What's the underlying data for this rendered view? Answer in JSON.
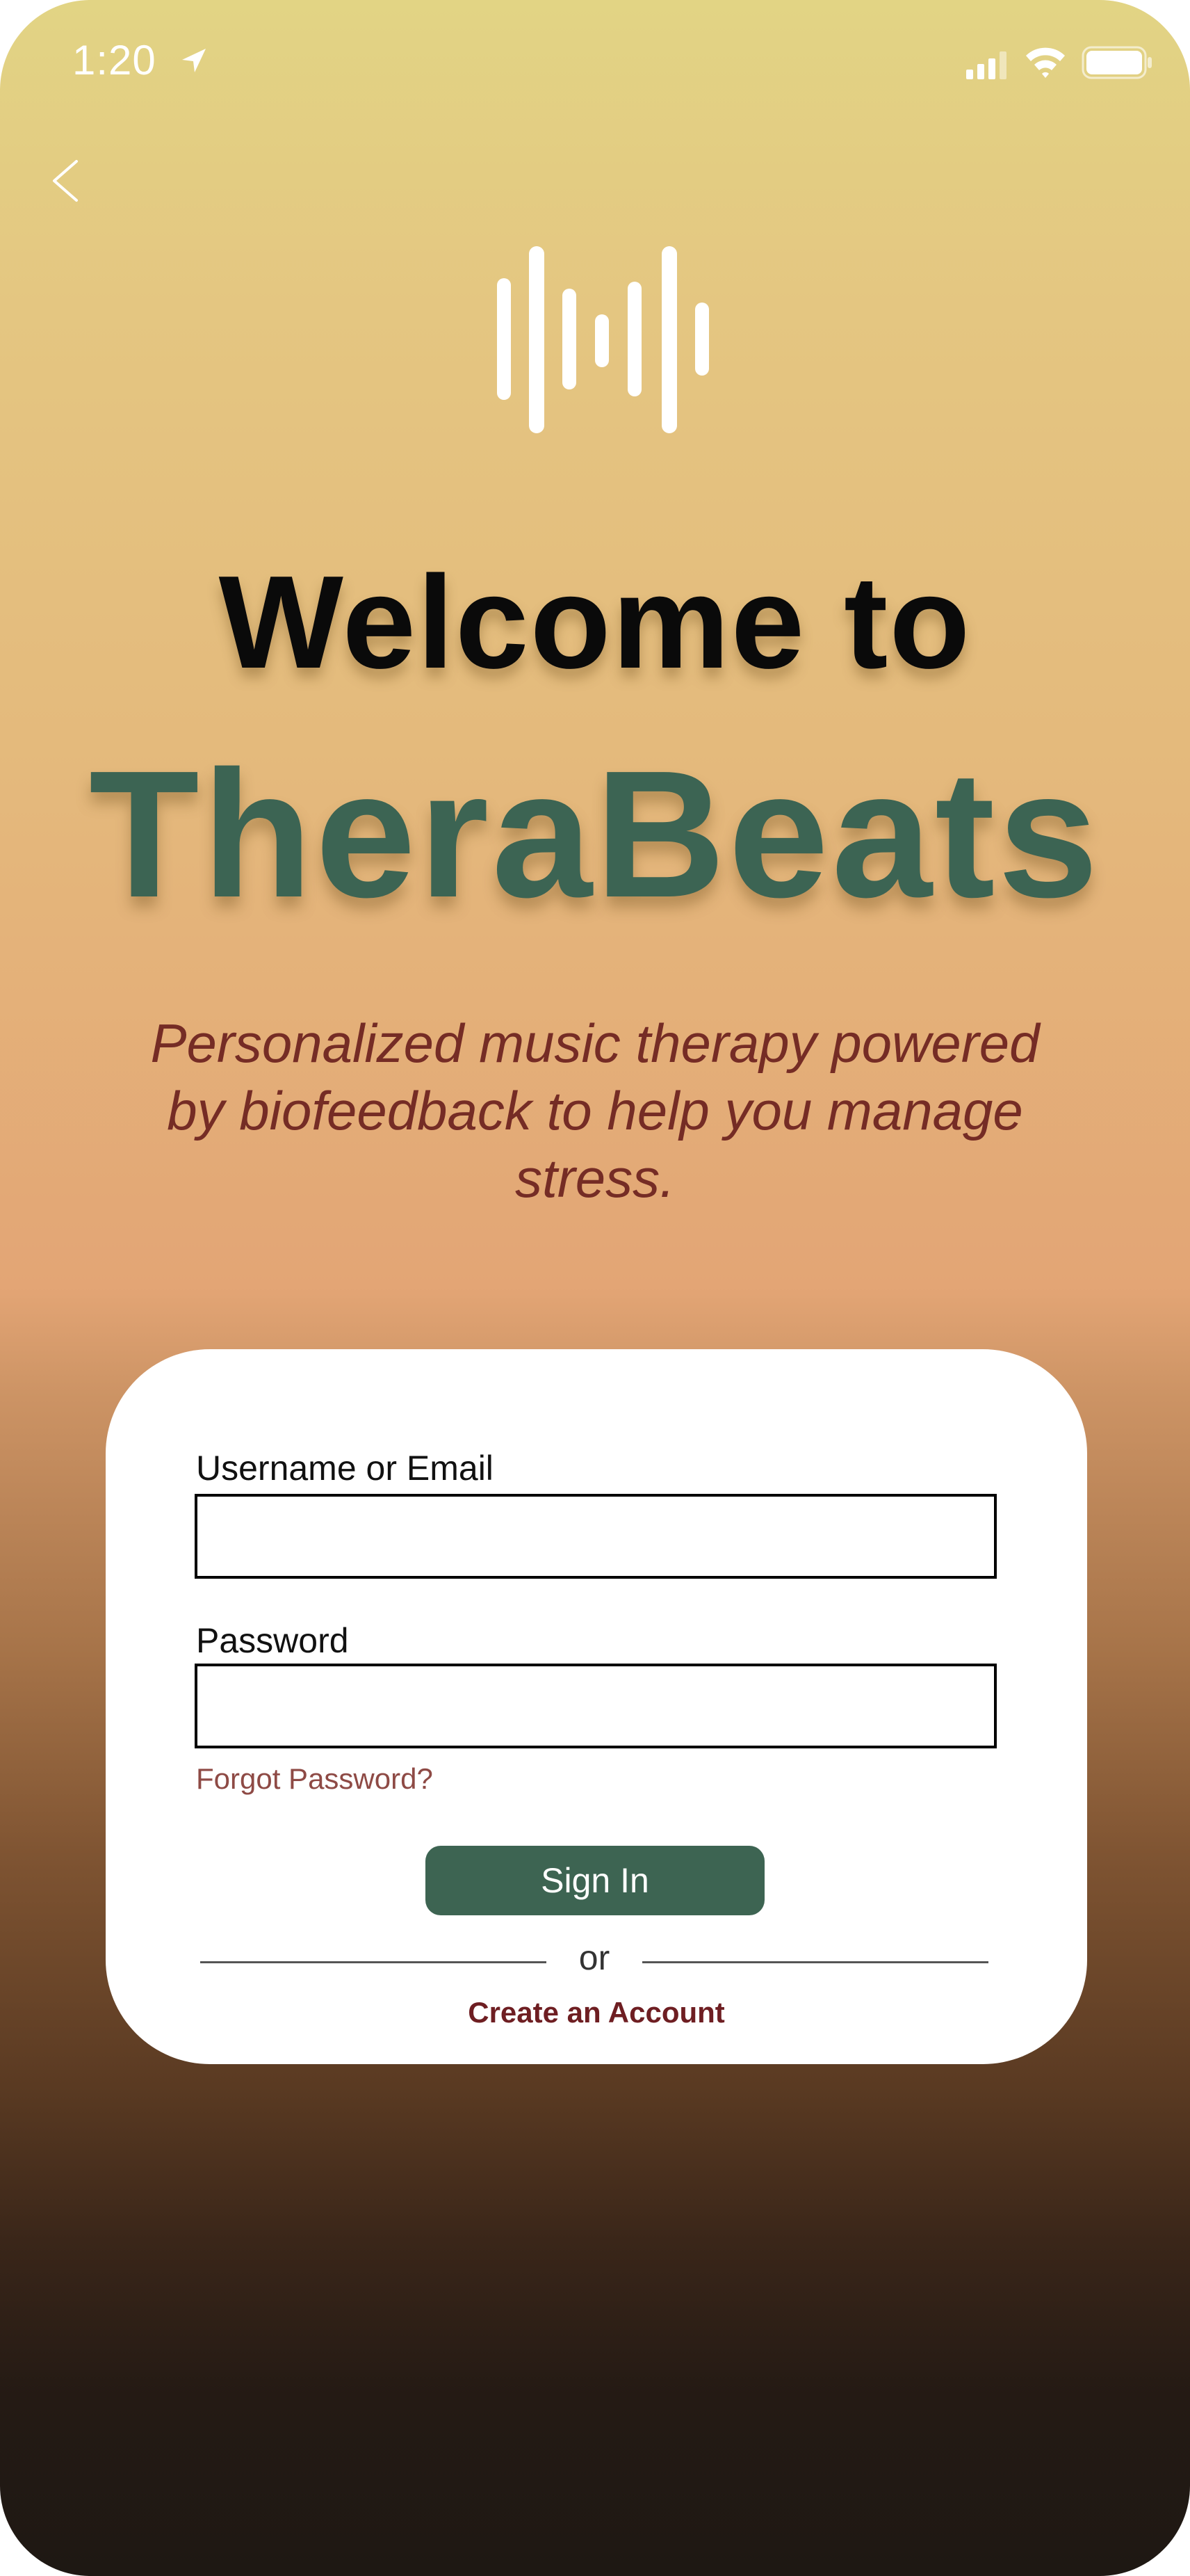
{
  "status_bar": {
    "time": "1:20",
    "icons": [
      "location-arrow-icon",
      "cellular-signal-icon",
      "wifi-icon",
      "battery-icon"
    ]
  },
  "header": {
    "back_icon": "chevron-left-icon",
    "logo_icon": "sound-wave-icon",
    "welcome_text": "Welcome to",
    "brand_name": "TheraBeats",
    "tagline": "Personalized music therapy powered by biofeedback to help you manage stress."
  },
  "login_form": {
    "username_label": "Username or Email",
    "username_value": "",
    "password_label": "Password",
    "password_value": "",
    "forgot_password": "Forgot Password?",
    "sign_in_label": "Sign In",
    "divider_text": "or",
    "create_account": "Create an Account"
  },
  "colors": {
    "brand_green": "#3c6453",
    "tagline_red": "#752c25",
    "link_red": "#6e1e22",
    "gradient_top": "#e2d484",
    "gradient_bottom": "#1e1813"
  }
}
